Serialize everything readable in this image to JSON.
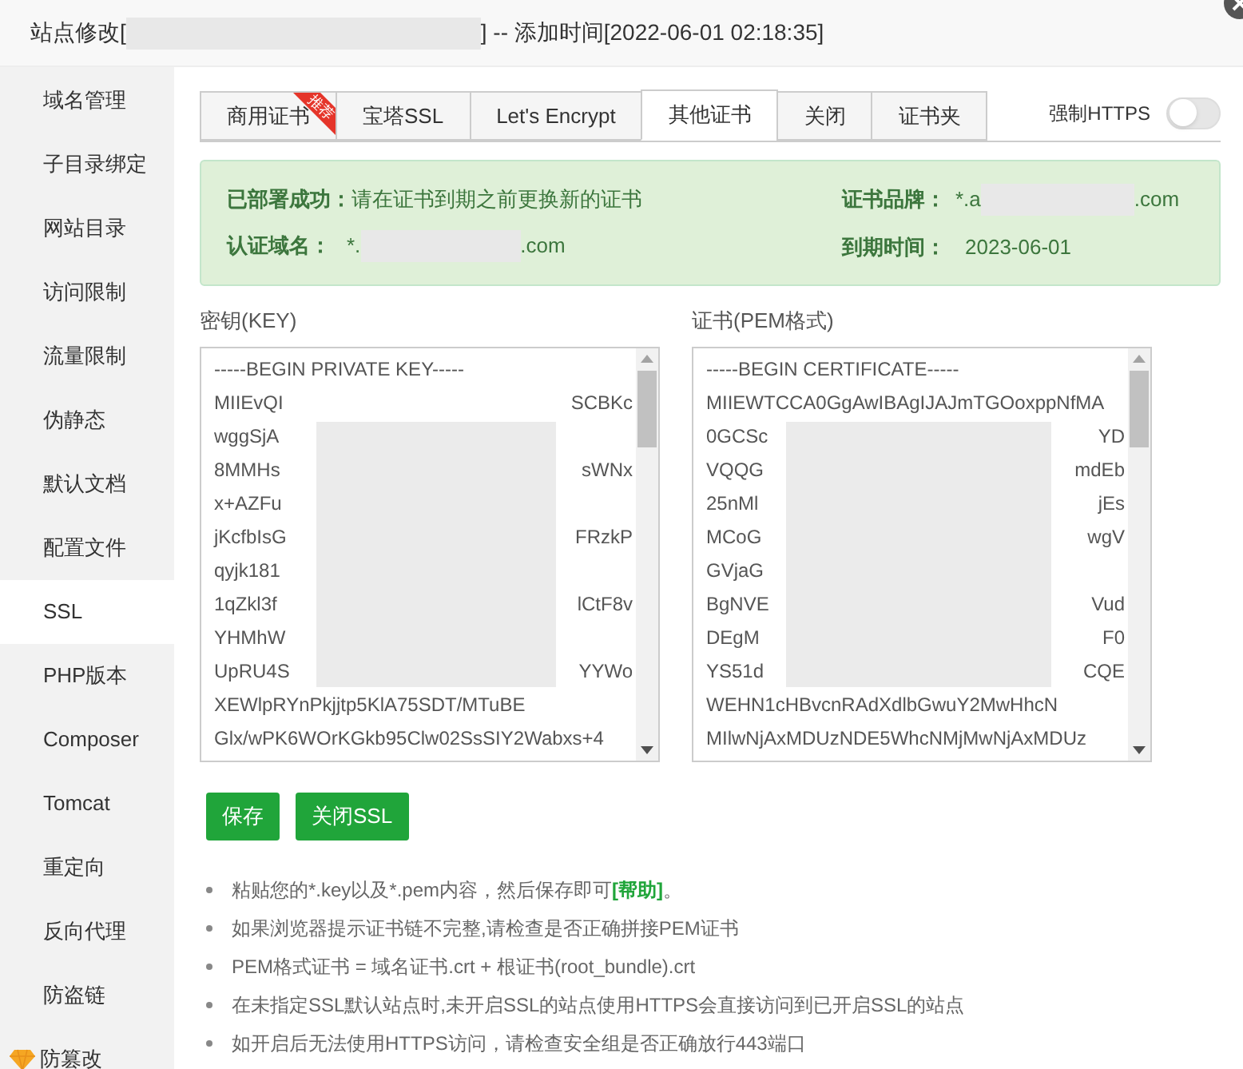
{
  "window": {
    "title_before": "站点修改[",
    "title_after": "] -- 添加时间[2022-06-01 02:18:35]"
  },
  "sidebar": {
    "items": [
      {
        "label": "域名管理",
        "selected": false
      },
      {
        "label": "子目录绑定",
        "selected": false
      },
      {
        "label": "网站目录",
        "selected": false
      },
      {
        "label": "访问限制",
        "selected": false
      },
      {
        "label": "流量限制",
        "selected": false
      },
      {
        "label": "伪静态",
        "selected": false
      },
      {
        "label": "默认文档",
        "selected": false
      },
      {
        "label": "配置文件",
        "selected": false
      },
      {
        "label": "SSL",
        "selected": true
      },
      {
        "label": "PHP版本",
        "selected": false
      },
      {
        "label": "Composer",
        "selected": false
      },
      {
        "label": "Tomcat",
        "selected": false
      },
      {
        "label": "重定向",
        "selected": false
      },
      {
        "label": "反向代理",
        "selected": false
      },
      {
        "label": "防盗链",
        "selected": false
      },
      {
        "label": "防篡改",
        "selected": false,
        "kind": "premium"
      }
    ]
  },
  "tabs": [
    {
      "label": "商用证书",
      "selected": false,
      "ribbon": "推荐"
    },
    {
      "label": "宝塔SSL",
      "selected": false
    },
    {
      "label": "Let's Encrypt",
      "selected": false
    },
    {
      "label": "其他证书",
      "selected": true
    },
    {
      "label": "关闭",
      "selected": false
    },
    {
      "label": "证书夹",
      "selected": false
    }
  ],
  "force_https": {
    "label": "强制HTTPS",
    "on": false
  },
  "status": {
    "deployed_label": "已部署成功：",
    "deployed_text": "请在证书到期之前更换新的证书",
    "domain_label": "认证域名：",
    "domain_before": "*.",
    "domain_after": ".com",
    "brand_label": "证书品牌：",
    "brand_before": "*.a",
    "brand_after": ".com",
    "expiry_label": "到期时间：",
    "expiry": "2023-06-01"
  },
  "key": {
    "label": "密钥(KEY)",
    "lines": [
      {
        "left": "-----BEGIN PRIVATE KEY-----"
      },
      {
        "left": "MIIEvQI",
        "right": "SCBKc"
      },
      {
        "left": "wggSjA"
      },
      {
        "left": "8MMHs",
        "right": "sWNx"
      },
      {
        "left": "x+AZFu"
      },
      {
        "left": "jKcfbIsG",
        "right": "FRzkP"
      },
      {
        "left": "qyjk181"
      },
      {
        "left": "1qZkl3f",
        "right": "lCtF8v"
      },
      {
        "left": "YHMhW"
      },
      {
        "left": "UpRU4S",
        "right": "YYWo"
      },
      {
        "left": "XEWlpRYnPkjjtp5KlA75SDT/MTuBE"
      },
      {
        "left": "Glx/wPK6WOrKGkb95Clw02SsSIY2Wabxs+4"
      }
    ]
  },
  "cert": {
    "label": "证书(PEM格式)",
    "lines": [
      {
        "left": "-----BEGIN CERTIFICATE-----"
      },
      {
        "left": "MIIEWTCCA0GgAwIBAgIJAJmTGOoxppNfMA"
      },
      {
        "left": "0GCSc",
        "right": "YD"
      },
      {
        "left": "VQQG",
        "right": "mdEb"
      },
      {
        "left": "25nMl",
        "right": "jEs"
      },
      {
        "left": "MCoG",
        "right": "wgV"
      },
      {
        "left": "GVjaG"
      },
      {
        "left": "BgNVE",
        "right": "Vud"
      },
      {
        "left": "DEgM",
        "right": "F0"
      },
      {
        "left": "YS51d",
        "right": "CQE"
      },
      {
        "left": "WEHN1cHBvcnRAdXdlbGwuY2MwHhcN"
      },
      {
        "left": "MIlwNjAxMDUzNDE5WhcNMjMwNjAxMDUz"
      }
    ]
  },
  "buttons": [
    {
      "label": "保存"
    },
    {
      "label": "关闭SSL"
    }
  ],
  "tips": [
    {
      "before": "粘贴您的*.key以及*.pem内容，然后保存即可",
      "link": "[帮助]",
      "after": "。"
    },
    {
      "before": "如果浏览器提示证书链不完整,请检查是否正确拼接PEM证书"
    },
    {
      "before": "PEM格式证书 = 域名证书.crt + 根证书(root_bundle).crt"
    },
    {
      "before": "在未指定SSL默认站点时,未开启SSL的站点使用HTTPS会直接访问到已开启SSL的站点"
    },
    {
      "before": "如开启后无法使用HTTPS访问，请检查安全组是否正确放行443端口"
    }
  ]
}
